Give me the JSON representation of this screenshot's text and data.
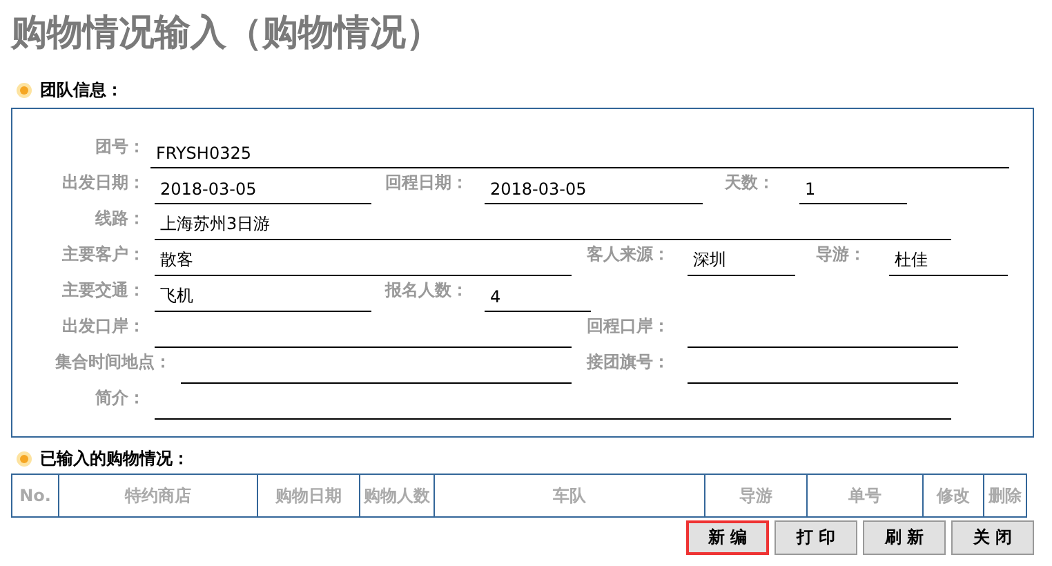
{
  "title": "购物情况输入（购物情况）",
  "team_section": {
    "heading": "团队信息：",
    "rows": [
      [
        {
          "label": "团号：",
          "value": "FRYSH0325"
        }
      ],
      [
        {
          "label": "出发日期：",
          "value": "2018-03-05"
        },
        {
          "label": "回程日期：",
          "value": "2018-03-05"
        },
        {
          "label": "天数：",
          "value": "1"
        }
      ],
      [
        {
          "label": "线路：",
          "value": "上海苏州3日游"
        }
      ],
      [
        {
          "label": "主要客户：",
          "value": "散客"
        },
        {
          "label": "客人来源：",
          "value": "深圳"
        },
        {
          "label": "导游：",
          "value": "杜佳"
        }
      ],
      [
        {
          "label": "主要交通：",
          "value": "飞机"
        },
        {
          "label": "报名人数：",
          "value": "4"
        }
      ],
      [
        {
          "label": "出发口岸："
        },
        {
          "label": "回程口岸："
        }
      ],
      [
        {
          "label": "集合时间地点："
        },
        {
          "label": "接团旗号："
        }
      ],
      [
        {
          "label": "简介："
        }
      ]
    ]
  },
  "shopping_section": {
    "heading": "已输入的购物情况：",
    "table": {
      "columns": [
        "No.",
        "特约商店",
        "购物日期",
        "购物人数",
        "车队",
        "导游",
        "单号",
        "修改",
        "删除"
      ]
    }
  },
  "buttons": [
    {
      "label": "新 编",
      "selected": true
    },
    {
      "label": "打 印",
      "selected": false
    },
    {
      "label": "刷 新",
      "selected": false
    },
    {
      "label": "关 闭",
      "selected": false
    }
  ]
}
